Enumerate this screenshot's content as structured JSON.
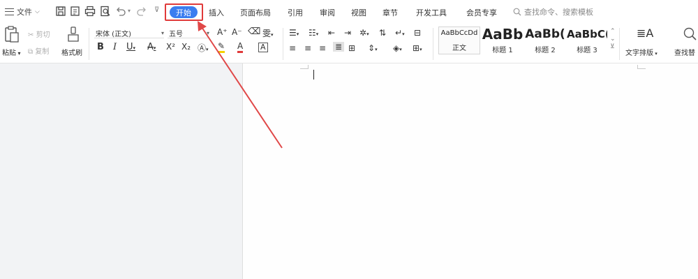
{
  "menu": {
    "file_label": "文件",
    "tabs": [
      "开始",
      "插入",
      "页面布局",
      "引用",
      "审阅",
      "视图",
      "章节",
      "开发工具",
      "会员专享"
    ],
    "active_tab": "开始",
    "search_placeholder": "查找命令、搜索模板"
  },
  "ribbon": {
    "paste_label": "粘贴",
    "cut_label": "剪切",
    "copy_label": "复制",
    "format_painter_label": "格式刷",
    "font_name": "宋体 (正文)",
    "font_size": "五号",
    "styles": [
      {
        "sample": "AaBbCcDd",
        "label": "正文"
      },
      {
        "sample": "AaBb",
        "label": "标题 1"
      },
      {
        "sample": "AaBb(",
        "label": "标题 2"
      },
      {
        "sample": "AaBbC(",
        "label": "标题 3"
      }
    ],
    "text_layout_label": "文字排版",
    "find_replace_label": "查找替"
  },
  "colors": {
    "active_tab_bg": "#3a7df0",
    "highlight_box": "#e03a3a",
    "font_color_underline": "#e03a3a",
    "highlight_underline": "#f5d000"
  }
}
